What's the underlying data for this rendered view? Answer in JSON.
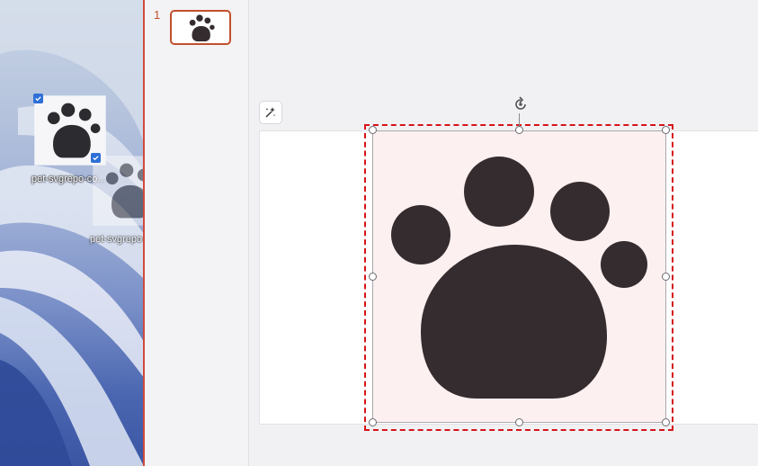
{
  "desktop": {
    "icons": [
      {
        "label": "pet-svgrepo-co...",
        "selected": true
      },
      {
        "label": "pet-svgrepo-com....",
        "selected": true
      }
    ]
  },
  "thumbnails": [
    {
      "number": "1"
    }
  ],
  "colors": {
    "accent": "#c1502d",
    "selection_dash": "#d4141a",
    "paw": "#352c2f",
    "image_bg": "#fdf0f0"
  },
  "icons": {
    "designer": "sparkle-wand-icon",
    "rotate": "rotate-icon",
    "paw": "paw-icon"
  }
}
